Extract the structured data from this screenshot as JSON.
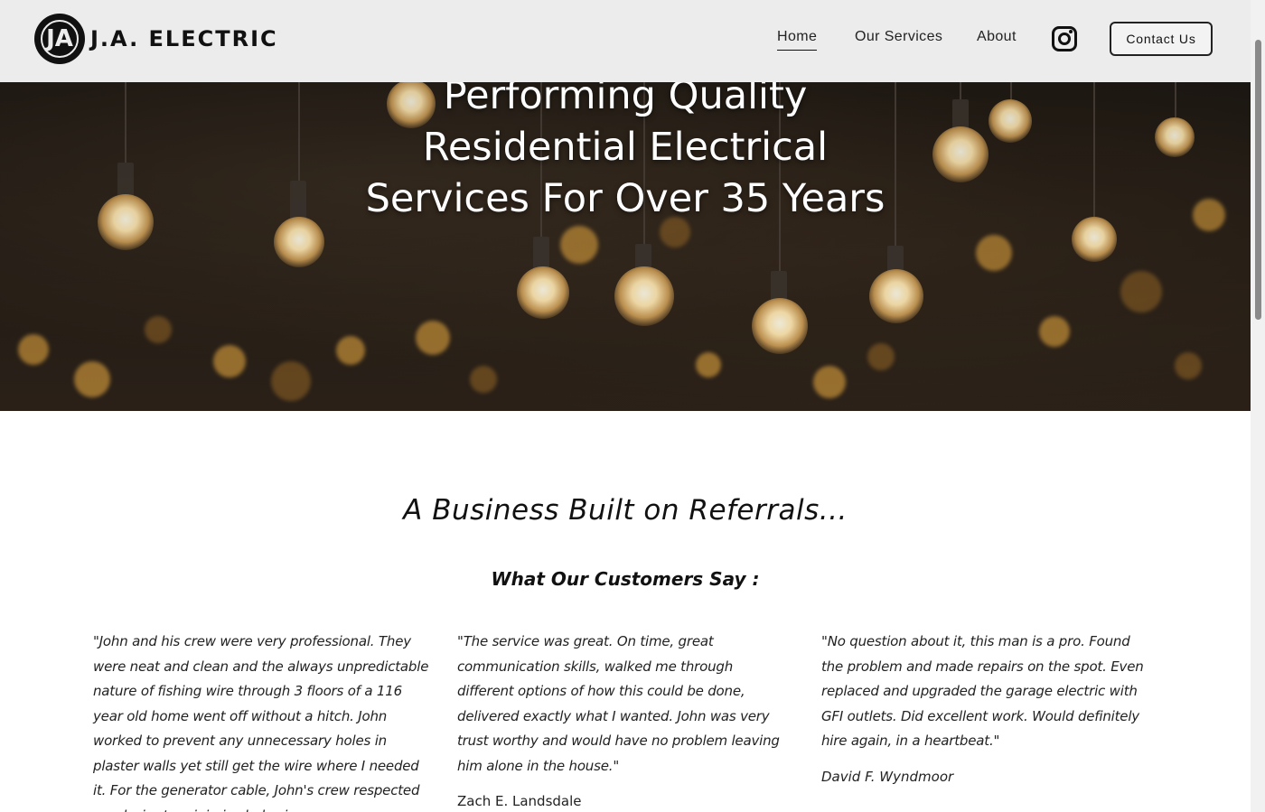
{
  "header": {
    "logo_mark": "JA",
    "logo_text": "J.A. ELECTRIC",
    "nav": {
      "home": "Home",
      "services": "Our Services",
      "about": "About"
    },
    "instagram_icon": "instagram-icon",
    "contact_label": "Contact Us"
  },
  "hero": {
    "title_lines": [
      "Performing Quality",
      "Residential Electrical",
      "Services For Over 35 Years"
    ]
  },
  "referrals": {
    "title": "A Business Built on Referrals...",
    "subtitle": "What Our Customers Say :",
    "testimonials": [
      {
        "text": "\"John and his crew were very professional. They were neat and clean and the always unpredictable nature of fishing wire through 3 floors of a 116 year old home went off without a hitch. John worked to prevent any unnecessary holes in plaster walls yet still get the wire where I needed it. For the generator cable, John's crew respected my desire to minimize holes in",
        "author": ""
      },
      {
        "text": "\"The service was great. On time, great communication skills, walked me through different options of how this could be done, delivered exactly what I wanted. John was very trust worthy and would have no problem leaving him alone in the house.\"",
        "author": "Zach E. Landsdale"
      },
      {
        "text": "\"No question about it, this man is a pro. Found the problem and made repairs on the spot. Even replaced and upgraded the garage electric with GFI outlets. Did excellent work. Would definitely hire again, in a heartbeat.\"",
        "author": "David F. Wyndmoor"
      }
    ]
  },
  "colors": {
    "header_bg": "#ececec",
    "text": "#111111",
    "hero_text": "#ffffff"
  }
}
